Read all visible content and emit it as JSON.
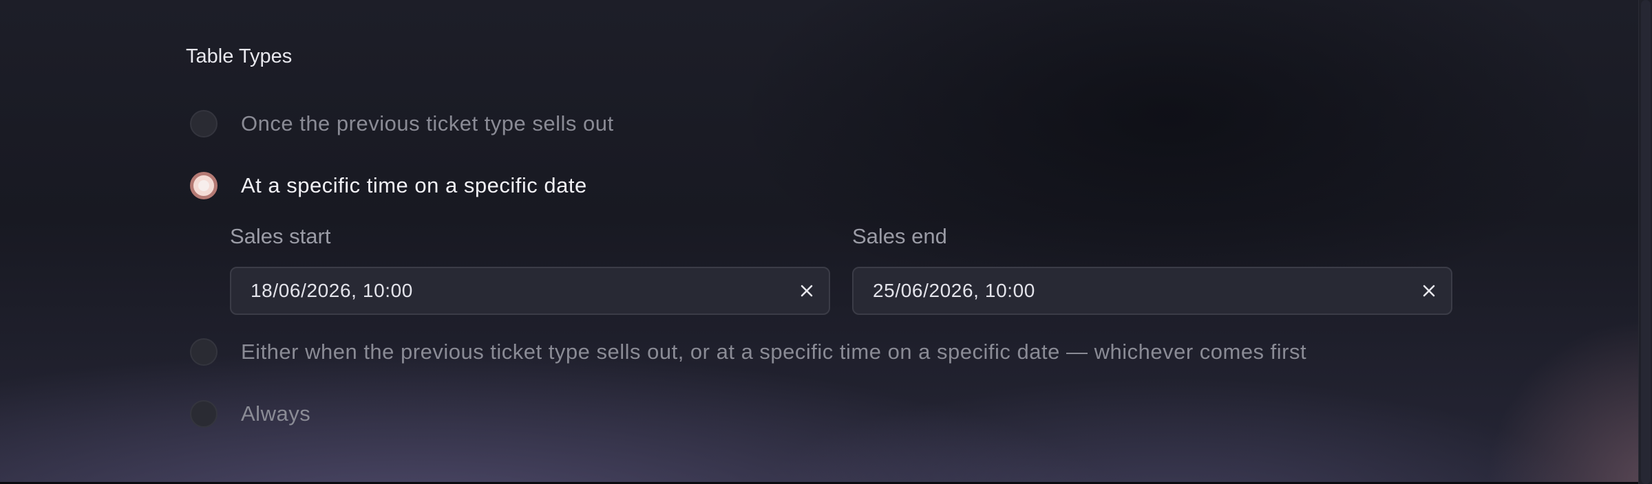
{
  "section": {
    "title": "Table Types"
  },
  "options": [
    {
      "label": "Once the previous ticket type sells out",
      "selected": false
    },
    {
      "label": "At a specific time on a specific date",
      "selected": true
    },
    {
      "label": "Either when the previous ticket type sells out, or at a specific time on a specific date — whichever comes first",
      "selected": false
    },
    {
      "label": "Always",
      "selected": false
    }
  ],
  "sales_start": {
    "label": "Sales start",
    "value": "18/06/2026, 10:00",
    "clear_icon": "close-icon"
  },
  "sales_end": {
    "label": "Sales end",
    "value": "25/06/2026, 10:00",
    "clear_icon": "close-icon"
  },
  "colors": {
    "accent": "#b57a74",
    "text_active": "#f1f1f5",
    "text_muted": "#8a8b95"
  }
}
